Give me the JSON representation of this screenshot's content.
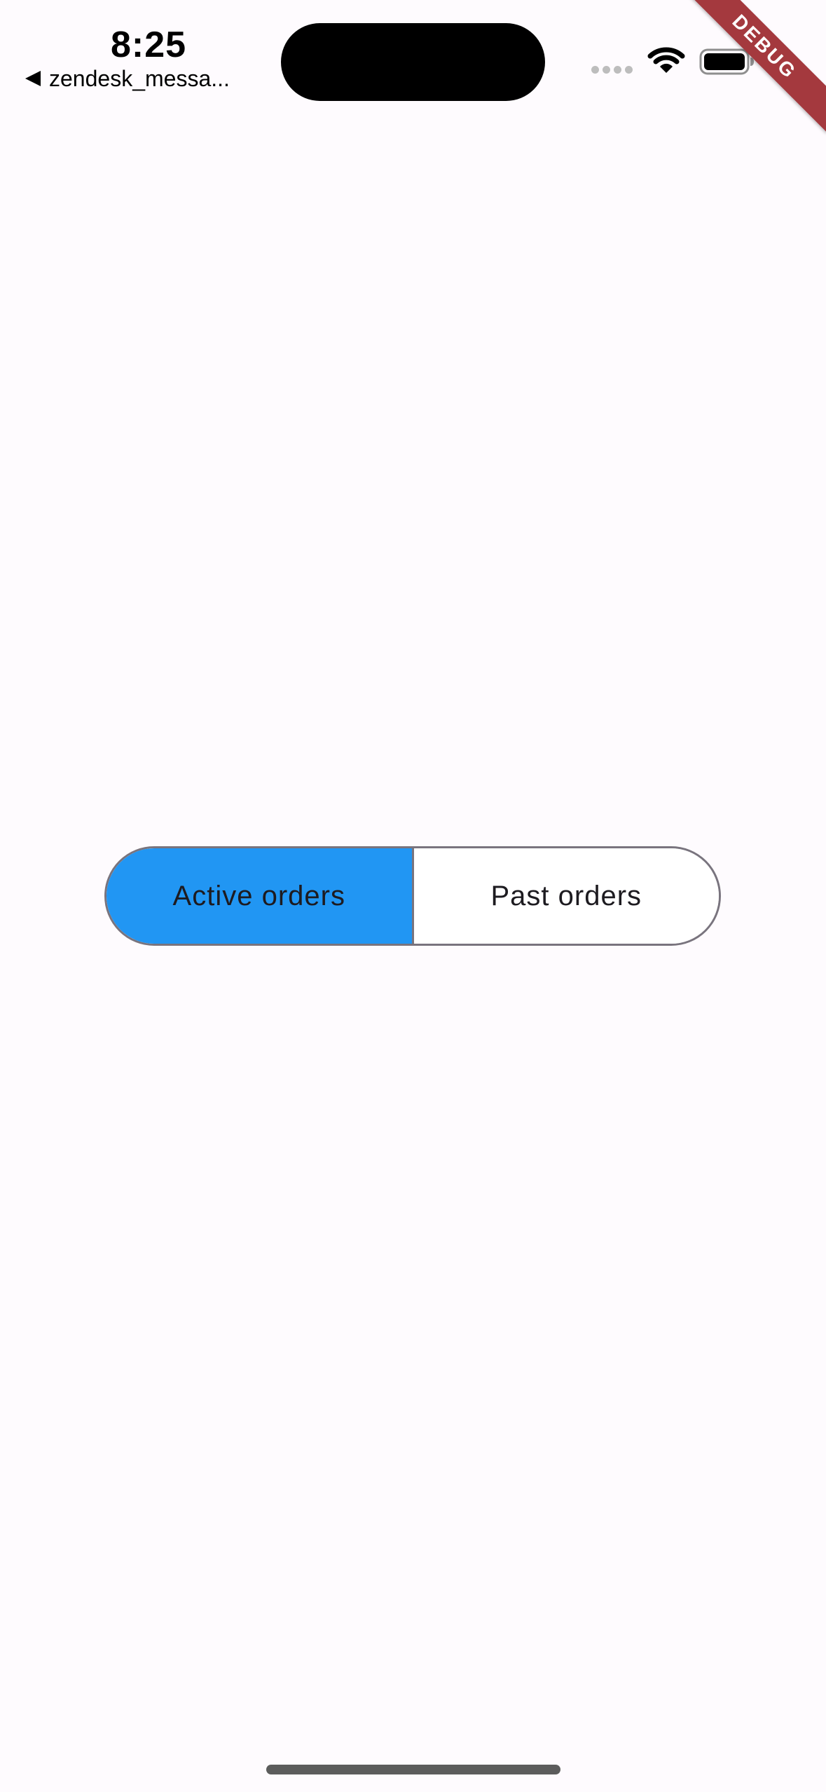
{
  "status_bar": {
    "time": "8:25",
    "back_app_label": "zendesk_messa..."
  },
  "debug_banner": {
    "label": "DEBUG",
    "color": "#a4393e"
  },
  "order_toggle": {
    "selected": "active",
    "active_label": "Active orders",
    "past_label": "Past orders",
    "selected_color": "#2196f3"
  },
  "icons": {
    "back": "back-arrow-icon",
    "cellular": "cellular-signal-icon",
    "wifi": "wifi-icon",
    "battery": "battery-icon"
  }
}
